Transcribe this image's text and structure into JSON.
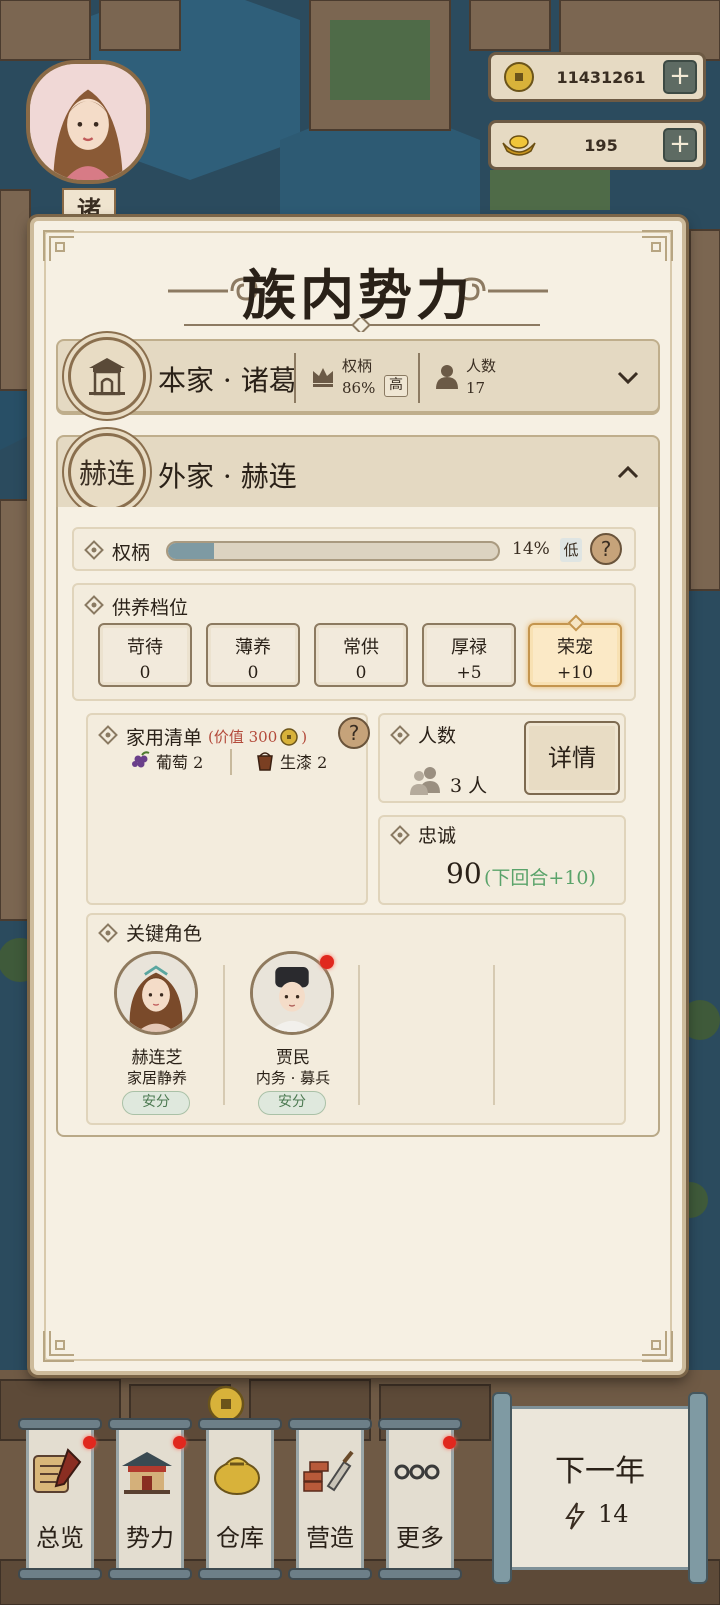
{
  "hud": {
    "avatar_name": "诸",
    "coins": "11431261",
    "gold": "195",
    "plus": "+"
  },
  "panel": {
    "title": "族内势力",
    "main_family": {
      "name": "本家 · 诸葛",
      "power_label": "权柄",
      "power_value": "86%",
      "power_level": "高",
      "people_label": "人数",
      "people_value": "17"
    },
    "outer_family": {
      "emblem_text": "赫连",
      "name": "外家 · 赫连",
      "power_label": "权柄",
      "power_percent": 14,
      "power_value": "14%",
      "power_level": "低",
      "help": "?",
      "support_label": "供养档位",
      "tiers": [
        {
          "name": "苛待",
          "value": "0"
        },
        {
          "name": "薄养",
          "value": "0"
        },
        {
          "name": "常供",
          "value": "0"
        },
        {
          "name": "厚禄",
          "value": "+5"
        },
        {
          "name": "荣宠",
          "value": "+10"
        }
      ],
      "active_tier": 4,
      "household_label": "家用清单",
      "household_value": "(价值 300",
      "household_close": ")",
      "items": [
        {
          "name": "葡萄 2",
          "icon": "grape-icon"
        },
        {
          "name": "生漆 2",
          "icon": "lacquer-bucket-icon"
        }
      ],
      "headcount_label": "人数",
      "headcount_value": "3 人",
      "details_button": "详情",
      "loyalty_label": "忠诚",
      "loyalty_value": "90",
      "loyalty_next": "(下回合+10)",
      "key_roles_label": "关键角色",
      "characters": [
        {
          "name": "赫连芝",
          "role": "家居静养",
          "status": "安分"
        },
        {
          "name": "贾民",
          "role": "内务 · 募兵",
          "status": "安分"
        }
      ]
    }
  },
  "bottom_bar": {
    "tabs": [
      {
        "label": "总览",
        "icon": "scroll-brush-icon",
        "notify": true
      },
      {
        "label": "势力",
        "icon": "palace-icon",
        "notify": true
      },
      {
        "label": "仓库",
        "icon": "money-bag-icon",
        "notify": false
      },
      {
        "label": "营造",
        "icon": "trowel-bricks-icon",
        "notify": false
      },
      {
        "label": "更多",
        "icon": "more-dots-icon",
        "notify": true
      }
    ],
    "next_year_label": "下一年",
    "next_year_energy": "14"
  },
  "colors": {
    "panel_bg": "#f6f0e3",
    "accent_brown": "#8a6f4e",
    "loyalty_green": "#5aa36a",
    "notify_red": "#e0281e",
    "bar_fill": "#7e9aa3"
  }
}
